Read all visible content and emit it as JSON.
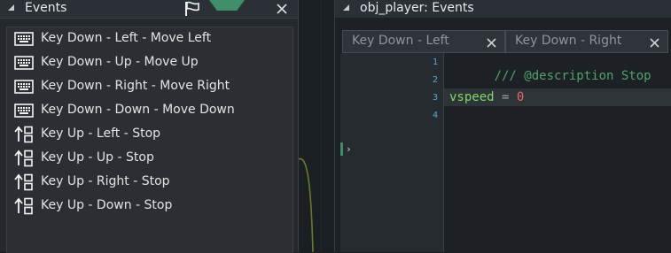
{
  "events_panel": {
    "title": "Events",
    "events": [
      {
        "label": "Key Down - Left - Move Left",
        "icon": "keyboard-icon"
      },
      {
        "label": "Key Down - Up - Move Up",
        "icon": "keyboard-icon"
      },
      {
        "label": "Key Down - Right - Move Right",
        "icon": "keyboard-icon"
      },
      {
        "label": "Key Down - Down - Move Down",
        "icon": "keyboard-icon"
      },
      {
        "label": "Key Up - Left - Stop",
        "icon": "key-release-icon"
      },
      {
        "label": "Key Up - Up - Stop",
        "icon": "key-release-icon"
      },
      {
        "label": "Key Up - Right - Stop",
        "icon": "key-release-icon"
      },
      {
        "label": "Key Up - Down - Stop",
        "icon": "key-release-icon"
      }
    ]
  },
  "code_window": {
    "title": "obj_player: Events",
    "tabs": [
      {
        "label": "Key Down - Left"
      },
      {
        "label": "Key Down - Right"
      }
    ],
    "line_numbers": [
      "1",
      "2",
      "3",
      "4"
    ],
    "lines": {
      "comment": "/// @description Stop",
      "var": "vspeed",
      "op": " = ",
      "num": "0"
    }
  },
  "colors": {
    "accent_green": "#3e8e6a",
    "comment": "#4fa36a",
    "variable": "#7fd96b",
    "number": "#e06a6a",
    "line_number": "#5aa7d6"
  }
}
